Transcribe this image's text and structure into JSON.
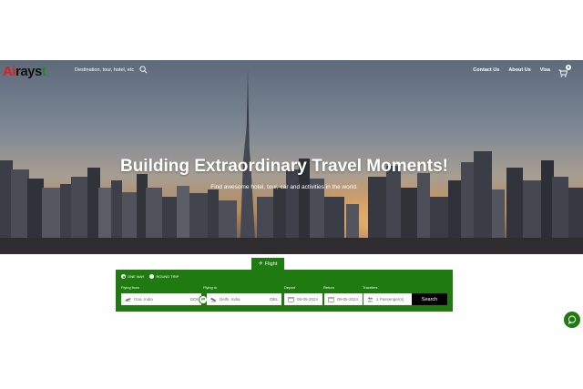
{
  "brand": {
    "logo_part1": "Ai",
    "logo_part2": "rays",
    "logo_part3": "t"
  },
  "header": {
    "search_placeholder": "Destination, tour, hotel, etc",
    "menu": [
      "Contact Us",
      "About Us",
      "Visa"
    ],
    "cart_count": "0"
  },
  "hero": {
    "title": "Building Extraordinary Travel Moments!",
    "subtitle": "Find awesome hotel, tour, car and activities in the world."
  },
  "booking": {
    "tab_label": "Flight",
    "trip_types": [
      "ONE WAY",
      "ROUND TRIP"
    ],
    "selected_trip": "ONE WAY",
    "labels": {
      "flying_from": "Flying from",
      "flying_to": "Flying to",
      "depart": "Depart",
      "return": "Return",
      "travelers": "Travelers"
    },
    "from_value": "Goa, India",
    "from_code": "GOI",
    "to_value": "Delhi, India",
    "to_code": "DEL",
    "depart_date": "08-05-2024",
    "return_date": "09-05-2024",
    "travelers_value": "1 Passenger(s)",
    "search_label": "Search"
  },
  "colors": {
    "brand_green": "#1f7a10",
    "logo_red": "#e21d1d"
  }
}
